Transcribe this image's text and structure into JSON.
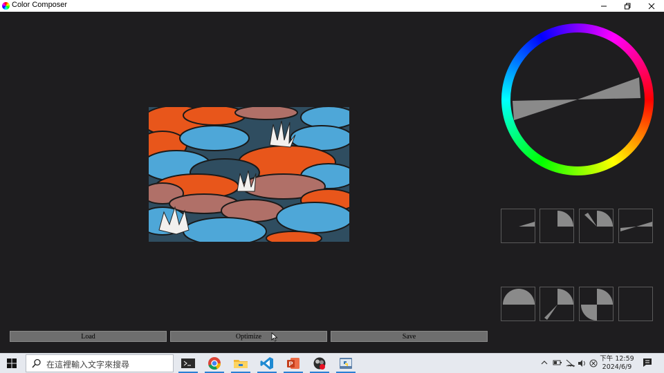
{
  "window": {
    "title": "Color Composer"
  },
  "buttons": {
    "load": "Load",
    "optimize": "Optimize",
    "save": "Save"
  },
  "taskbar": {
    "search_placeholder": "在這裡輸入文字來搜尋",
    "apps": [
      "terminal-icon",
      "chrome-icon",
      "file-explorer-icon",
      "vscode-icon",
      "powerpoint-icon",
      "obs-icon",
      "python-icon"
    ],
    "clock_time": "下午 12:59",
    "clock_date": "2024/6/9"
  },
  "colors": {
    "accent_gray": "#8a8a8a",
    "background": "#1e1d1f"
  }
}
